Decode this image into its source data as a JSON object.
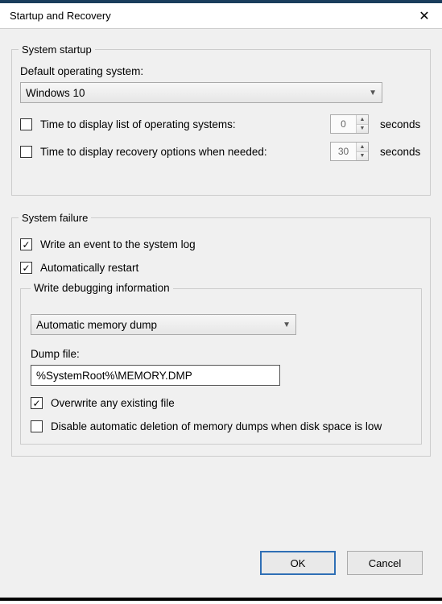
{
  "window": {
    "title": "Startup and Recovery",
    "close_glyph": "✕"
  },
  "startup": {
    "legend": "System startup",
    "default_os_label": "Default operating system:",
    "default_os_value": "Windows 10",
    "chk_list_os_label": "Time to display list of operating systems:",
    "chk_list_os_checked": false,
    "list_os_seconds": "0",
    "chk_recovery_label": "Time to display recovery options when needed:",
    "chk_recovery_checked": false,
    "recovery_seconds": "30",
    "seconds_unit": "seconds"
  },
  "failure": {
    "legend": "System failure",
    "chk_write_event_label": "Write an event to the system log",
    "chk_write_event_checked": true,
    "chk_auto_restart_label": "Automatically restart",
    "chk_auto_restart_checked": true,
    "debug_group_label": "Write debugging information",
    "debug_combo_value": "Automatic memory dump",
    "dump_file_label": "Dump file:",
    "dump_file_value": "%SystemRoot%\\MEMORY.DMP",
    "chk_overwrite_label": "Overwrite any existing file",
    "chk_overwrite_checked": true,
    "chk_disable_delete_label": "Disable automatic deletion of memory dumps when disk space is low",
    "chk_disable_delete_checked": false
  },
  "buttons": {
    "ok": "OK",
    "cancel": "Cancel"
  },
  "glyphs": {
    "checkmark": "✓",
    "chevron_down": "▼",
    "tri_up": "▲",
    "tri_down": "▼"
  }
}
